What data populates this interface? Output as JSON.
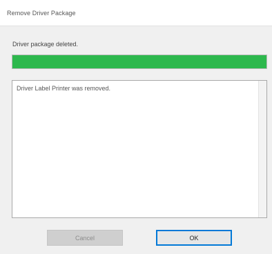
{
  "window": {
    "title": "Remove Driver Package"
  },
  "status": {
    "text": "Driver package deleted.",
    "progress_percent": 100,
    "progress_color": "#2db84d"
  },
  "log": {
    "lines": [
      "Driver Label Printer was removed."
    ]
  },
  "buttons": {
    "cancel_label": "Cancel",
    "ok_label": "OK"
  },
  "colors": {
    "accent": "#0078d7"
  }
}
